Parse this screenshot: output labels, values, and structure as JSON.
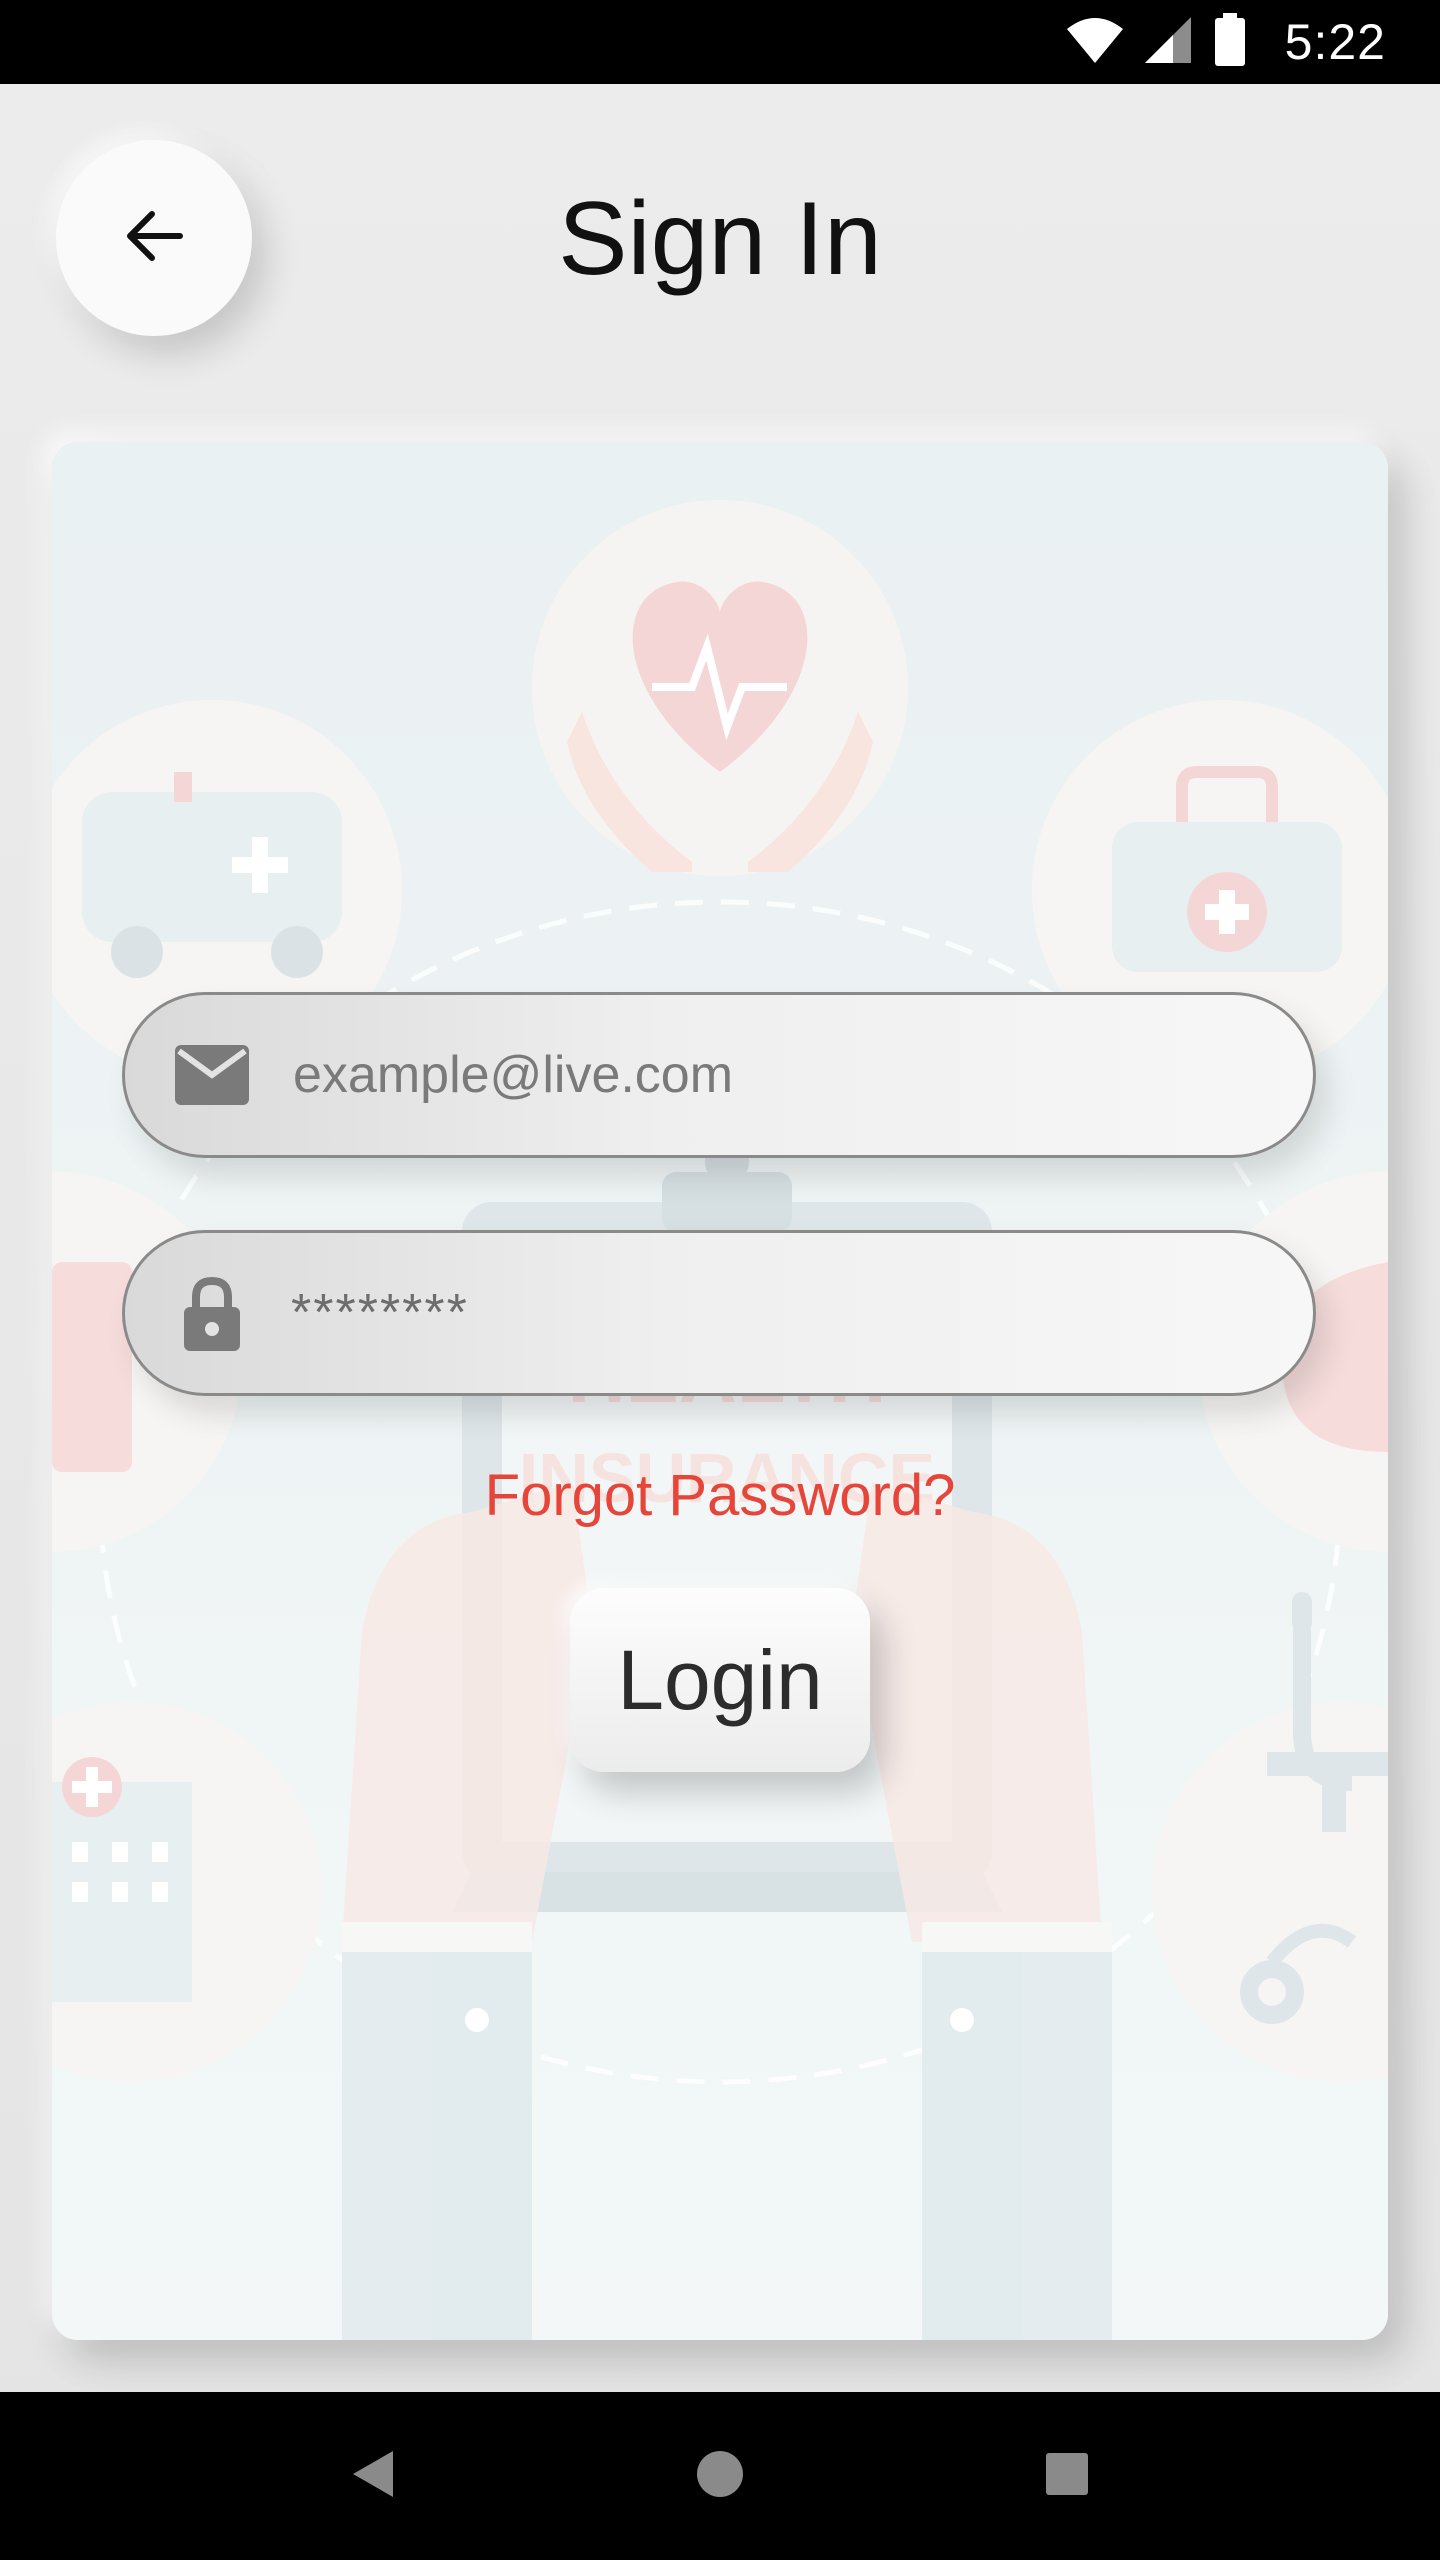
{
  "status_bar": {
    "time": "5:22",
    "icons": [
      "wifi-icon",
      "cellular-signal-icon",
      "battery-icon"
    ]
  },
  "header": {
    "title": "Sign In",
    "back_icon": "arrow-left-icon"
  },
  "form": {
    "email": {
      "icon": "mail-icon",
      "placeholder": "example@live.com",
      "value": ""
    },
    "password": {
      "icon": "lock-icon",
      "value": "********"
    },
    "forgot_password_label": "Forgot Password?",
    "login_label": "Login"
  },
  "illustration": {
    "icons": [
      "heart-hands-icon",
      "ambulance-icon",
      "first-aid-kit-icon",
      "clipboard-icon",
      "hospital-icon",
      "stethoscope-icon"
    ],
    "faded_text": [
      "HEALTH",
      "INSURANCE"
    ]
  },
  "nav_bar": {
    "icons": [
      "back-triangle-icon",
      "home-circle-icon",
      "recents-square-icon"
    ]
  },
  "colors": {
    "accent_red": "#e6453a",
    "background": "#e8e8e8",
    "card_tint": "#e8f1f3"
  }
}
